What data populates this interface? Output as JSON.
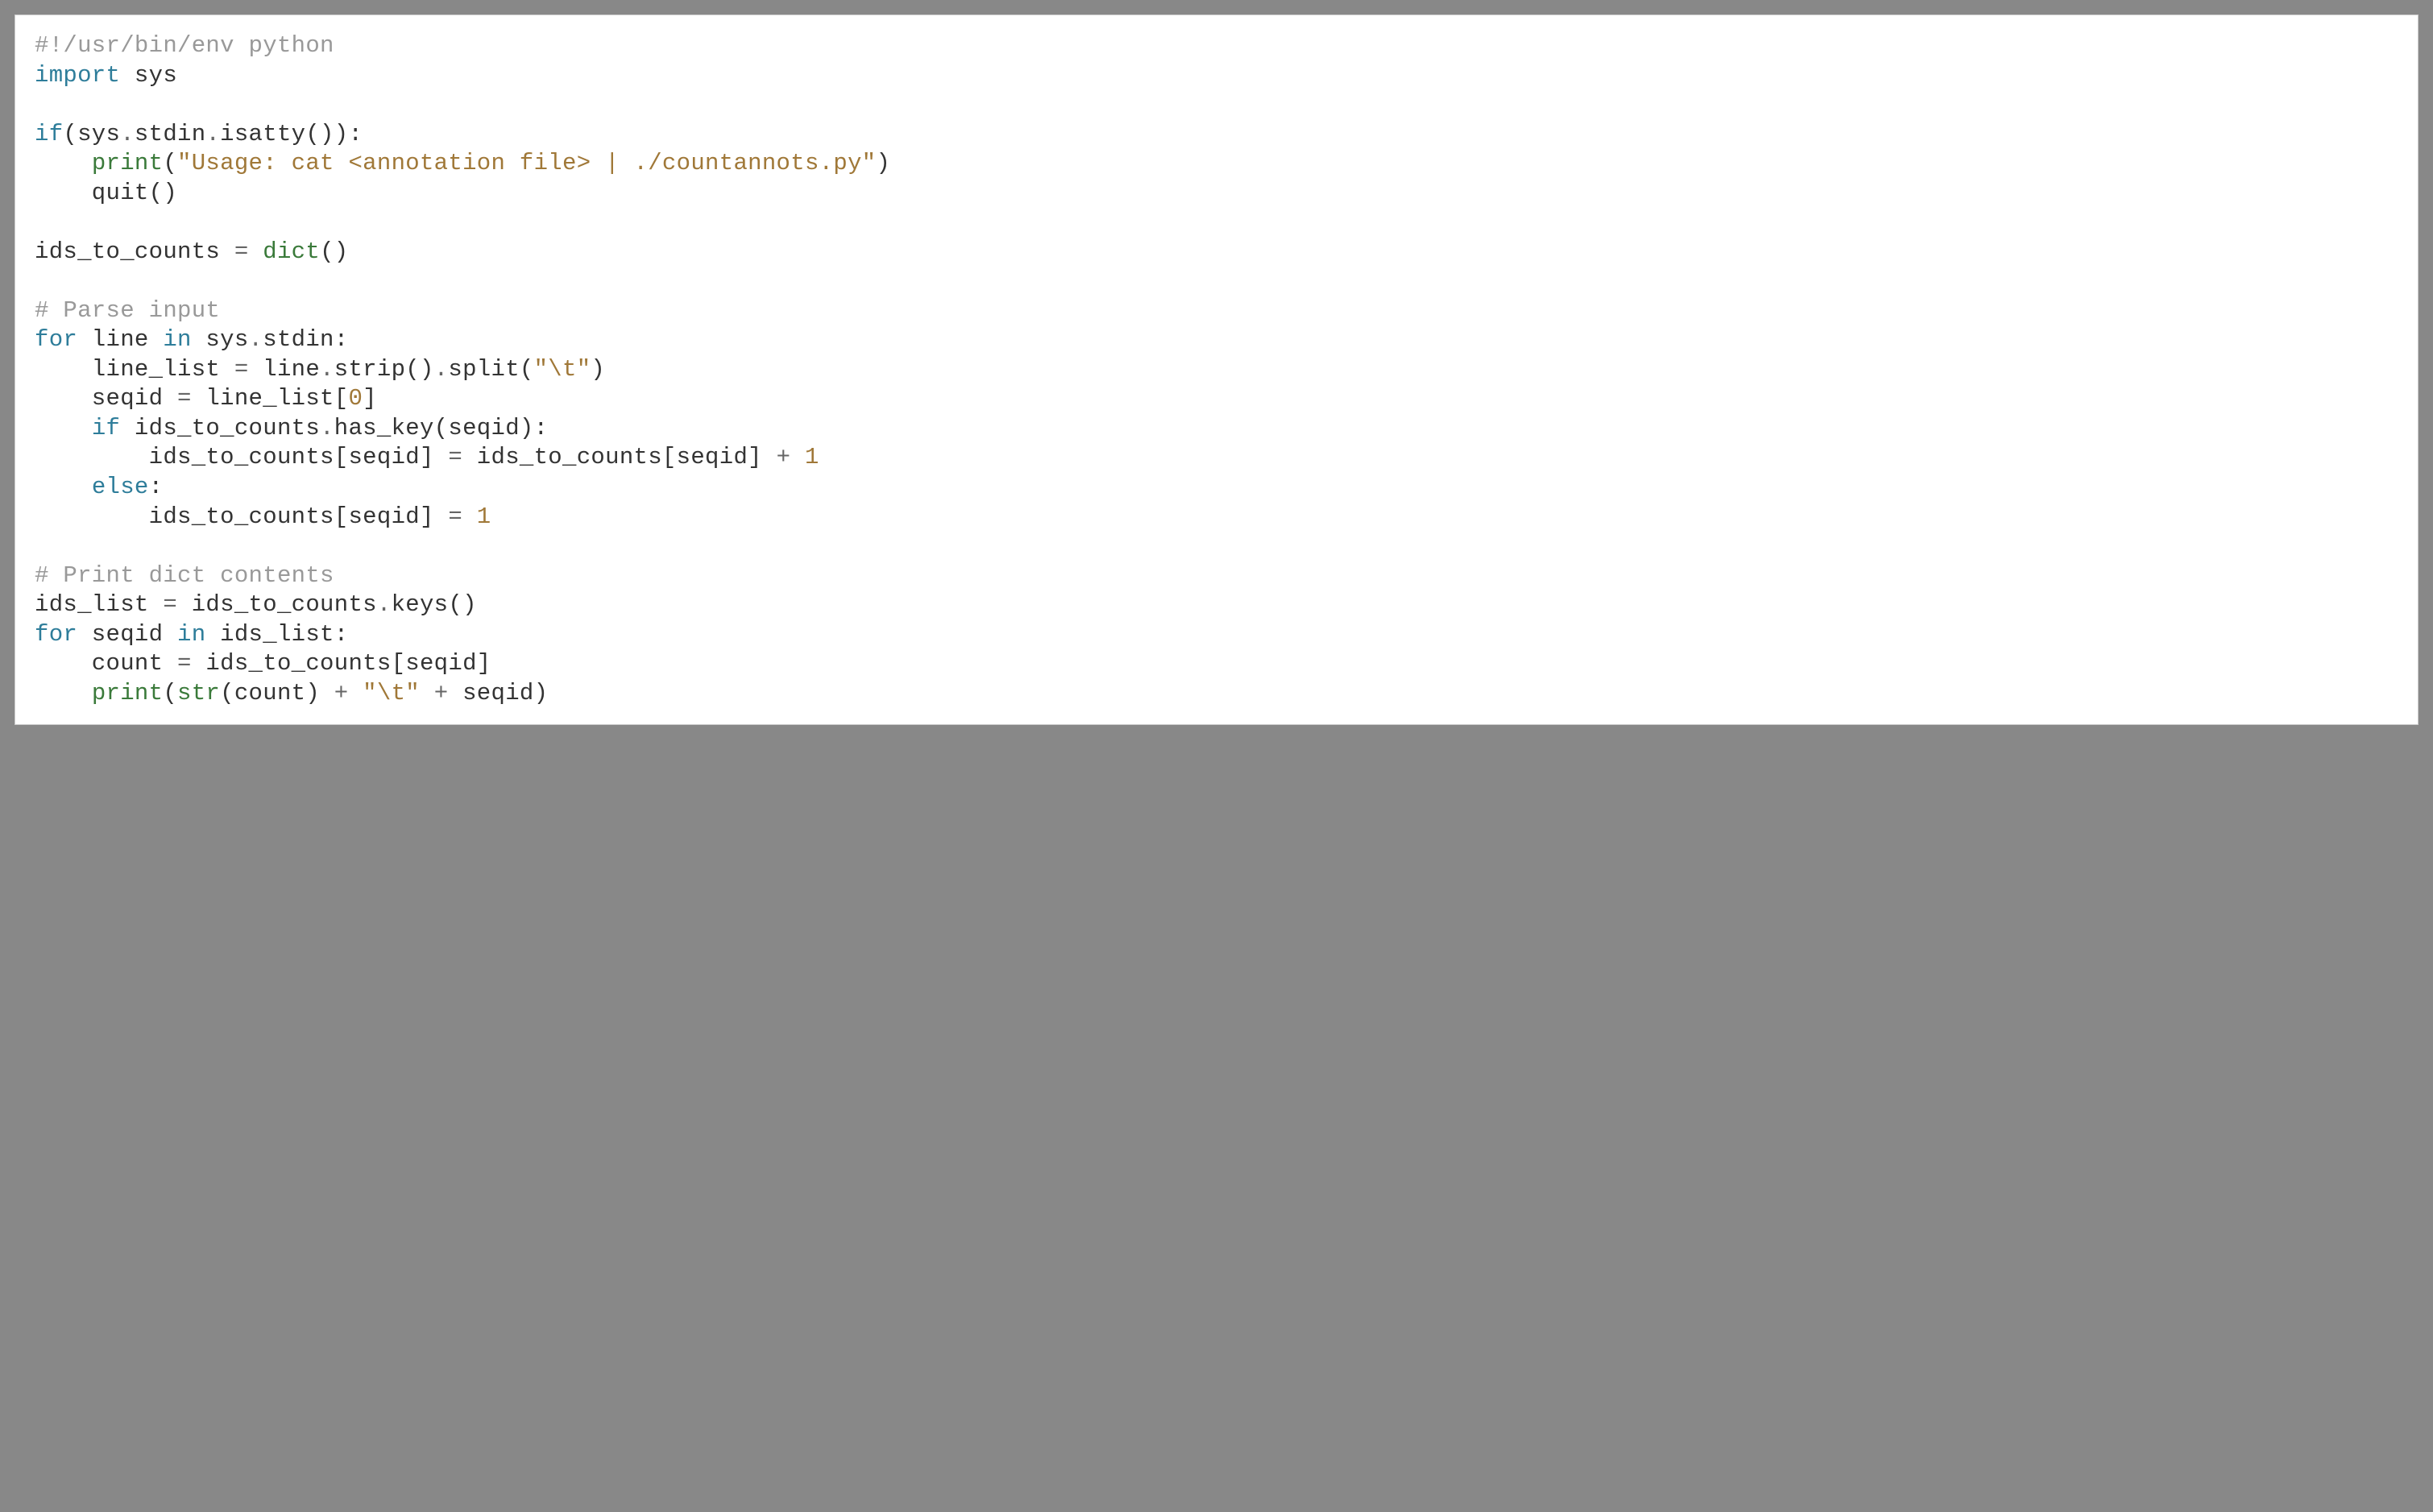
{
  "code": {
    "lines": [
      [
        {
          "cls": "comment",
          "text": "#!/usr/bin/env python"
        }
      ],
      [
        {
          "cls": "keyword",
          "text": "import"
        },
        {
          "cls": "default",
          "text": " sys"
        }
      ],
      [
        {
          "cls": "default",
          "text": ""
        }
      ],
      [
        {
          "cls": "keyword",
          "text": "if"
        },
        {
          "cls": "paren",
          "text": "(sys"
        },
        {
          "cls": "operator",
          "text": "."
        },
        {
          "cls": "default",
          "text": "stdin"
        },
        {
          "cls": "operator",
          "text": "."
        },
        {
          "cls": "default",
          "text": "isatty()):"
        }
      ],
      [
        {
          "cls": "default",
          "text": "    "
        },
        {
          "cls": "builtin",
          "text": "print"
        },
        {
          "cls": "paren",
          "text": "("
        },
        {
          "cls": "string",
          "text": "\"Usage: cat <annotation file> | ./countannots.py\""
        },
        {
          "cls": "paren",
          "text": ")"
        }
      ],
      [
        {
          "cls": "default",
          "text": "    quit()"
        }
      ],
      [
        {
          "cls": "default",
          "text": ""
        }
      ],
      [
        {
          "cls": "default",
          "text": "ids_to_counts "
        },
        {
          "cls": "operator",
          "text": "="
        },
        {
          "cls": "default",
          "text": " "
        },
        {
          "cls": "builtin",
          "text": "dict"
        },
        {
          "cls": "paren",
          "text": "()"
        }
      ],
      [
        {
          "cls": "default",
          "text": ""
        }
      ],
      [
        {
          "cls": "comment",
          "text": "# Parse input"
        }
      ],
      [
        {
          "cls": "keyword",
          "text": "for"
        },
        {
          "cls": "default",
          "text": " line "
        },
        {
          "cls": "keyword",
          "text": "in"
        },
        {
          "cls": "default",
          "text": " sys"
        },
        {
          "cls": "operator",
          "text": "."
        },
        {
          "cls": "default",
          "text": "stdin:"
        }
      ],
      [
        {
          "cls": "default",
          "text": "    line_list "
        },
        {
          "cls": "operator",
          "text": "="
        },
        {
          "cls": "default",
          "text": " line"
        },
        {
          "cls": "operator",
          "text": "."
        },
        {
          "cls": "default",
          "text": "strip()"
        },
        {
          "cls": "operator",
          "text": "."
        },
        {
          "cls": "default",
          "text": "split("
        },
        {
          "cls": "string",
          "text": "\"\\t\""
        },
        {
          "cls": "paren",
          "text": ")"
        }
      ],
      [
        {
          "cls": "default",
          "text": "    seqid "
        },
        {
          "cls": "operator",
          "text": "="
        },
        {
          "cls": "default",
          "text": " line_list["
        },
        {
          "cls": "number",
          "text": "0"
        },
        {
          "cls": "default",
          "text": "]"
        }
      ],
      [
        {
          "cls": "default",
          "text": "    "
        },
        {
          "cls": "keyword",
          "text": "if"
        },
        {
          "cls": "default",
          "text": " ids_to_counts"
        },
        {
          "cls": "operator",
          "text": "."
        },
        {
          "cls": "default",
          "text": "has_key(seqid):"
        }
      ],
      [
        {
          "cls": "default",
          "text": "        ids_to_counts[seqid] "
        },
        {
          "cls": "operator",
          "text": "="
        },
        {
          "cls": "default",
          "text": " ids_to_counts[seqid] "
        },
        {
          "cls": "operator",
          "text": "+"
        },
        {
          "cls": "default",
          "text": " "
        },
        {
          "cls": "number",
          "text": "1"
        }
      ],
      [
        {
          "cls": "default",
          "text": "    "
        },
        {
          "cls": "keyword",
          "text": "else"
        },
        {
          "cls": "default",
          "text": ":"
        }
      ],
      [
        {
          "cls": "default",
          "text": "        ids_to_counts[seqid] "
        },
        {
          "cls": "operator",
          "text": "="
        },
        {
          "cls": "default",
          "text": " "
        },
        {
          "cls": "number",
          "text": "1"
        }
      ],
      [
        {
          "cls": "default",
          "text": ""
        }
      ],
      [
        {
          "cls": "comment",
          "text": "# Print dict contents"
        }
      ],
      [
        {
          "cls": "default",
          "text": "ids_list "
        },
        {
          "cls": "operator",
          "text": "="
        },
        {
          "cls": "default",
          "text": " ids_to_counts"
        },
        {
          "cls": "operator",
          "text": "."
        },
        {
          "cls": "default",
          "text": "keys()"
        }
      ],
      [
        {
          "cls": "keyword",
          "text": "for"
        },
        {
          "cls": "default",
          "text": " seqid "
        },
        {
          "cls": "keyword",
          "text": "in"
        },
        {
          "cls": "default",
          "text": " ids_list:"
        }
      ],
      [
        {
          "cls": "default",
          "text": "    count "
        },
        {
          "cls": "operator",
          "text": "="
        },
        {
          "cls": "default",
          "text": " ids_to_counts[seqid]"
        }
      ],
      [
        {
          "cls": "default",
          "text": "    "
        },
        {
          "cls": "builtin",
          "text": "print"
        },
        {
          "cls": "paren",
          "text": "("
        },
        {
          "cls": "builtin",
          "text": "str"
        },
        {
          "cls": "paren",
          "text": "(count) "
        },
        {
          "cls": "operator",
          "text": "+"
        },
        {
          "cls": "default",
          "text": " "
        },
        {
          "cls": "string",
          "text": "\"\\t\""
        },
        {
          "cls": "default",
          "text": " "
        },
        {
          "cls": "operator",
          "text": "+"
        },
        {
          "cls": "default",
          "text": " seqid)"
        }
      ]
    ]
  }
}
